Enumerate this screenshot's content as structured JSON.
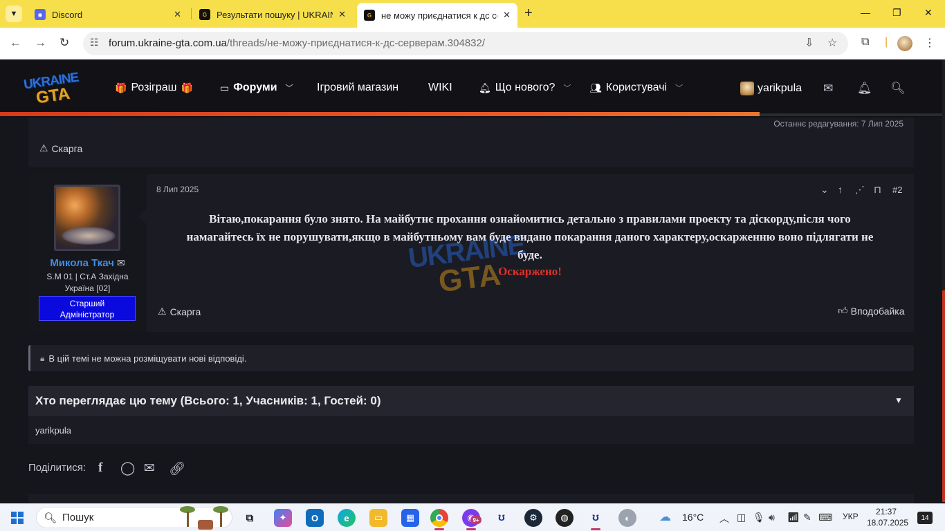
{
  "browser": {
    "tabs": [
      {
        "title": "Discord",
        "close": "✕"
      },
      {
        "title": "Результати пошуку | UKRAINE GTA",
        "close": "✕"
      },
      {
        "title": "не можу приєднатися к дс серверам",
        "close": "✕"
      }
    ],
    "new_tab": "+",
    "url_host": "forum.ukraine-gta.com.ua",
    "url_path": "/threads/не-можу-приєднатися-к-дс-серверам.304832/",
    "window_controls": {
      "minimize": "—",
      "restore": "❐",
      "close": "✕"
    }
  },
  "site": {
    "logo_line1": "UKRAINE",
    "logo_line2": "GTA",
    "nav": {
      "giveaway": "Розіграш",
      "forums": "Форуми",
      "shop": "Ігровий магазин",
      "wiki": "WIKI",
      "whats_new": "Що нового?",
      "users": "Користувачі"
    },
    "username": "yarikpula"
  },
  "previous_post": {
    "edited": "Останнє редагування: 7 Лип 2025",
    "report": "Скарга"
  },
  "post": {
    "author": "Микола Ткач",
    "user_title_line1": "S.M 01 | Ст.А Західна",
    "user_title_line2": "Україна [02]",
    "banner_line1": "Старший",
    "banner_line2": "Адміністратор",
    "date": "8 Лип 2025",
    "number": "#2",
    "body_line1": "Вітаю,покарання було знято. На майбутнє прохання ознайомитись детально з правилами проекту та діскорду,після чого",
    "body_line2": "намагайтесь їх не порушувати,якщо в майбутньому вам буде видано покарання даного характеру,оскарженню воно підлягати не",
    "body_line3": "буде.",
    "appeal": "Оскаржено!",
    "report": "Скарга",
    "like": "Вподобайка",
    "watermark_line1": "UKRAINE",
    "watermark_line2": "GTA"
  },
  "thread": {
    "locked_notice": "В цій темі не можна розміщувати нові відповіді.",
    "viewers_title": "Хто переглядає цю тему (Всього: 1, Учасників: 1, Гостей: 0)",
    "viewers_list": "yarikpula",
    "share_label": "Поділитися:"
  },
  "taskbar": {
    "search_label": "Пошук",
    "weather": "16°C",
    "language": "УКР",
    "time": "21:37",
    "date": "18.07.2025",
    "notifications": "14",
    "badge": "9+"
  },
  "colors": {
    "accent_red": "#d63a1c",
    "tab_bar": "#f6df4a",
    "user_link": "#3d8ee6",
    "admin_banner": "#0a0adf",
    "appeal_red": "#e0322a"
  }
}
